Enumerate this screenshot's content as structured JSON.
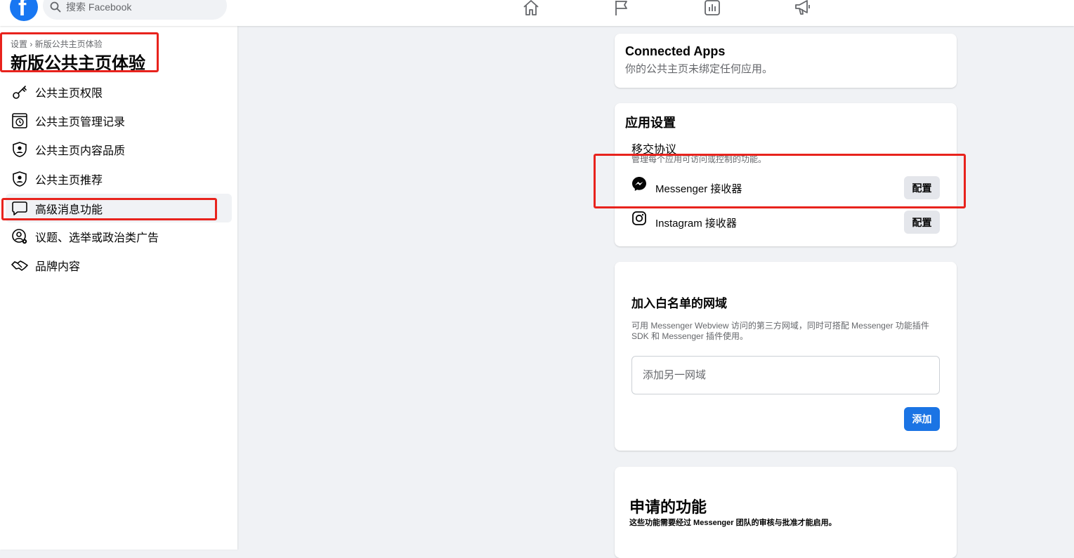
{
  "topbar": {
    "logo_letter": "f",
    "search_placeholder": "搜索 Facebook",
    "nav_icons": [
      "home-icon",
      "flag-icon",
      "chart-icon",
      "megaphone-icon"
    ]
  },
  "sidebar": {
    "breadcrumb": "设置 › 新版公共主页体验",
    "title": "新版公共主页体验",
    "items": [
      {
        "label": "公共主页权限",
        "icon": "key-icon"
      },
      {
        "label": "公共主页管理记录",
        "icon": "history-icon"
      },
      {
        "label": "公共主页内容品质",
        "icon": "shield-person-icon"
      },
      {
        "label": "公共主页推荐",
        "icon": "shield-person-icon"
      },
      {
        "label": "高级消息功能",
        "icon": "chat-bubble-icon",
        "active": true
      },
      {
        "label": "议题、选举或政治类广告",
        "icon": "person-gear-icon"
      },
      {
        "label": "品牌内容",
        "icon": "handshake-icon"
      }
    ]
  },
  "connected_apps": {
    "title": "Connected Apps",
    "subtitle": "你的公共主页未绑定任何应用。"
  },
  "app_settings": {
    "title": "应用设置",
    "section_title": "移交协议",
    "section_desc": "管理每个应用可访问或控制的功能。",
    "rows": [
      {
        "label": "Messenger 接收器",
        "icon": "messenger-icon",
        "button": "配置"
      },
      {
        "label": "Instagram 接收器",
        "icon": "instagram-icon",
        "button": "配置"
      }
    ]
  },
  "whitelist": {
    "title": "加入白名单的网域",
    "desc_line1": "可用 Messenger Webview 访问的第三方网域，同时可搭配 Messenger 功能插件",
    "desc_line2": "SDK 和 Messenger 插件使用。",
    "input_placeholder": "添加另一网域",
    "add_button": "添加"
  },
  "requested_features": {
    "title": "申请的功能",
    "desc": "这些功能需要经过 Messenger 团队的审核与批准才能启用。"
  },
  "colors": {
    "brand": "#1877f2",
    "button_blue": "#1b74e4",
    "highlight_red": "#e8231d",
    "page_bg": "#f0f2f5"
  }
}
